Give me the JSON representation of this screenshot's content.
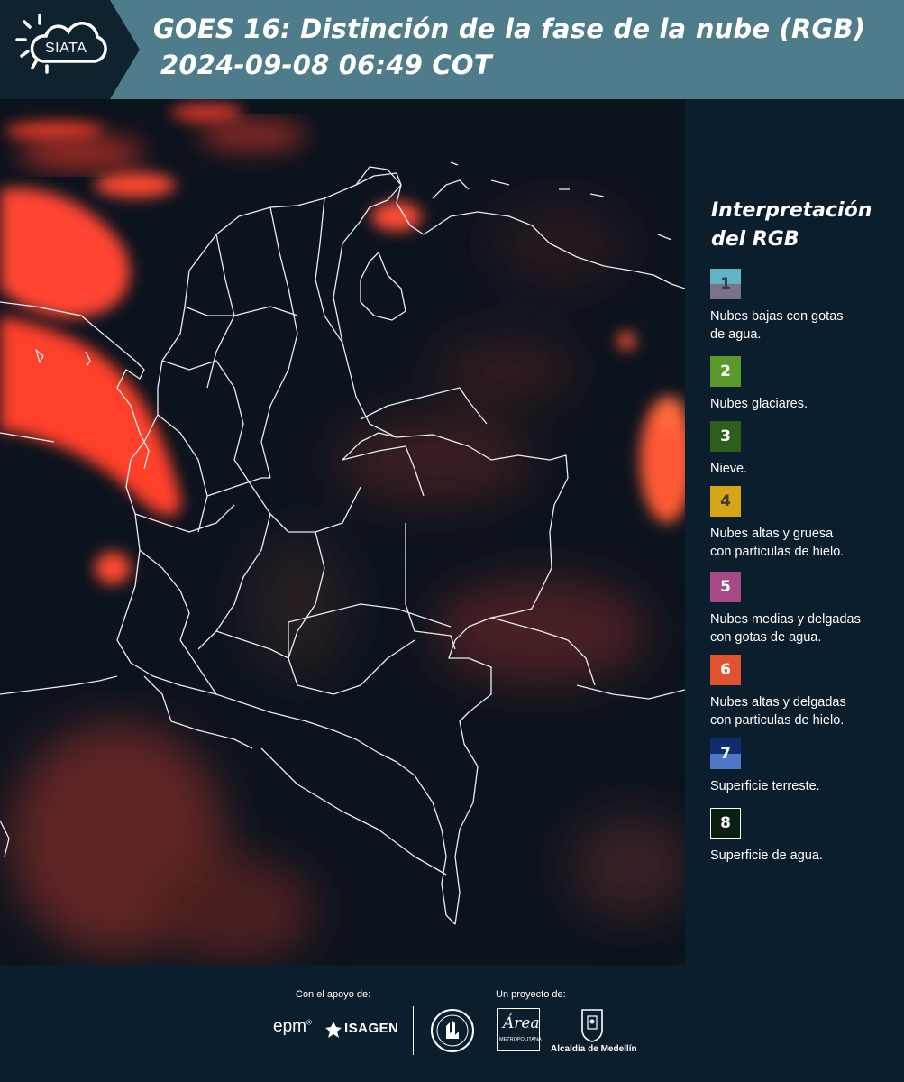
{
  "header": {
    "logo_text": "SIATA",
    "title_line1": "GOES 16: Distinción de la fase de la nube (RGB)",
    "title_line2": "2024-09-08 06:49 COT"
  },
  "legend": {
    "title_line1": "Interpretación",
    "title_line2": "del RGB",
    "items": [
      {
        "number": "1",
        "label_line1": "Nubes bajas con gotas",
        "label_line2": "de agua.",
        "color_top": "#62b3c4",
        "color_bottom": "#7a7289",
        "text_color": "#3b3b4a"
      },
      {
        "number": "2",
        "label_line1": "Nubes glaciares.",
        "label_line2": "",
        "color_top": "#5a9a2c",
        "color_bottom": "#5a9a2c",
        "text_color": "#ffffff"
      },
      {
        "number": "3",
        "label_line1": "Nieve.",
        "label_line2": "",
        "color_top": "#2d5e1c",
        "color_bottom": "#2d5e1c",
        "text_color": "#ffffff"
      },
      {
        "number": "4",
        "label_line1": "Nubes altas y gruesa",
        "label_line2": "con particulas de hielo.",
        "color_top": "#d6a618",
        "color_bottom": "#d6a618",
        "text_color": "#3b3b3b"
      },
      {
        "number": "5",
        "label_line1": "Nubes medias y delgadas",
        "label_line2": "con gotas de agua.",
        "color_top": "#a54a86",
        "color_bottom": "#a54a86",
        "text_color": "#ffffff"
      },
      {
        "number": "6",
        "label_line1": "Nubes altas y delgadas",
        "label_line2": "con particulas de hielo.",
        "color_top": "#e1532f",
        "color_bottom": "#e1532f",
        "text_color": "#ffffff"
      },
      {
        "number": "7",
        "label_line1": "Superficie terreste.",
        "label_line2": "",
        "color_top": "#0f2d6e",
        "color_bottom": "#4f77c8",
        "text_color": "#ffffff"
      },
      {
        "number": "8",
        "label_line1": "Superficie de agua.",
        "label_line2": "",
        "color_top": "#0b1e12",
        "color_bottom": "#0b1e12",
        "text_color": "#ffffff"
      }
    ]
  },
  "footer": {
    "support_label": "Con el apoyo de:",
    "project_label": "Un proyecto de:",
    "sponsor1": "epm",
    "sponsor2": "ISAGEN",
    "partner_area": "Área",
    "partner_area_sub": "METROPOLITANA",
    "partner_alcaldia": "Alcaldía de Medellín"
  },
  "colors": {
    "header_bg": "#4f7c8b",
    "logo_band": "#0e2230",
    "panel_bg": "#0b1e2e",
    "cloud_red": "#ff4a30"
  }
}
